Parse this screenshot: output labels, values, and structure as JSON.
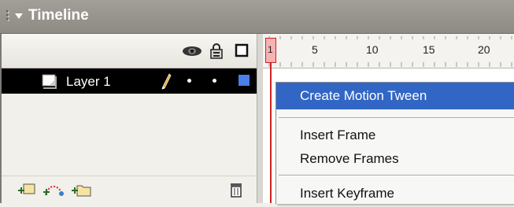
{
  "panel": {
    "title": "Timeline"
  },
  "layer_header": {
    "icons": [
      "eye-icon",
      "lock-icon",
      "outline-icon"
    ]
  },
  "layers": [
    {
      "name": "Layer 1",
      "icon": "layer-page-icon",
      "edit_icon": "pencil-icon",
      "visible_marker": "•",
      "lock_marker": "•",
      "color": "#4a7ee8",
      "selected": true
    }
  ],
  "layer_footer": {
    "icons": [
      "insert-layer-icon",
      "add-motion-guide-icon",
      "insert-layer-folder-icon",
      "delete-layer-icon"
    ]
  },
  "ruler": {
    "current_frame": "1",
    "labels": [
      "5",
      "10",
      "15",
      "20"
    ]
  },
  "context_menu": {
    "items": [
      {
        "label": "Create Motion Tween",
        "highlighted": true
      },
      {
        "separator": true
      },
      {
        "label": "Insert Frame"
      },
      {
        "label": "Remove Frames"
      },
      {
        "separator": true
      },
      {
        "label": "Insert Keyframe"
      }
    ]
  },
  "colors": {
    "title_bar": "#98948e",
    "selected_row": "#000000",
    "menu_highlight": "#3166c5",
    "playhead": "#cc2222"
  }
}
